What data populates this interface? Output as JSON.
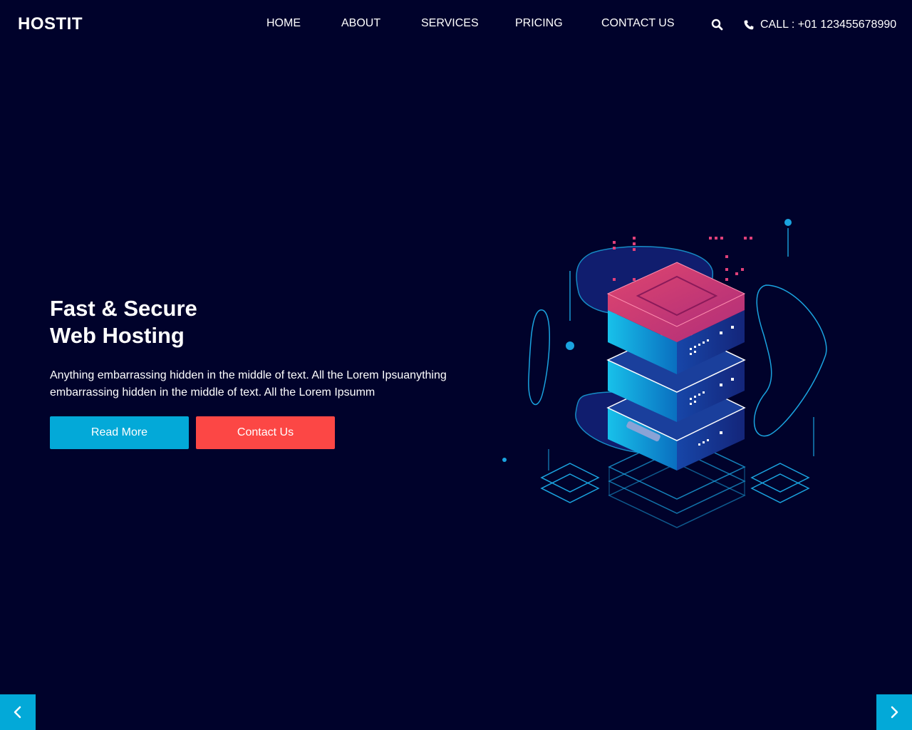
{
  "header": {
    "brand": "HOSTIT",
    "nav": [
      {
        "label": "HOME"
      },
      {
        "label": "ABOUT"
      },
      {
        "label": "SERVICES"
      },
      {
        "label": "PRICING"
      },
      {
        "label": "CONTACT US"
      }
    ],
    "search_icon": "search-icon",
    "call_icon": "phone-icon",
    "call_text": "CALL : +01 123455678990"
  },
  "hero": {
    "title_line1": "Fast & Secure",
    "title_line2": "Web Hosting",
    "description": "Anything embarrassing hidden in the middle of text. All the Lorem Ipsuanything embarrassing hidden in the middle of text. All the Lorem Ipsumm",
    "read_more_label": "Read More",
    "contact_label": "Contact Us"
  },
  "slider": {
    "prev_icon": "chevron-left-icon",
    "next_icon": "chevron-right-icon"
  },
  "colors": {
    "background": "#00022b",
    "accent_blue": "#03a9d8",
    "accent_red": "#fc4745",
    "text": "#ffffff"
  }
}
